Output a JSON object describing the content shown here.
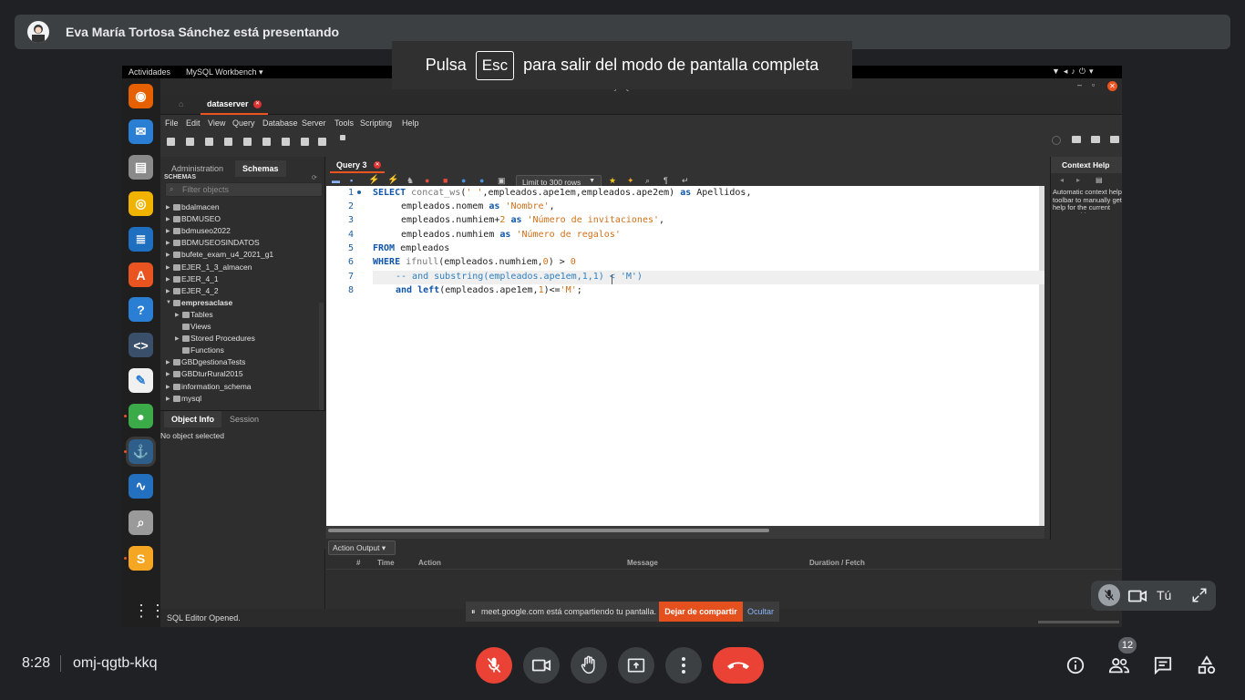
{
  "presenter": {
    "name": "Eva María Tortosa Sánchez está presentando"
  },
  "fullscreen_hint": {
    "prefix": "Pulsa",
    "key": "Esc",
    "suffix": "para salir del modo de pantalla completa"
  },
  "ubuntu": {
    "activities": "Actividades",
    "app_menu": "MySQL Workbench ▾"
  },
  "dock": [
    {
      "name": "firefox-icon",
      "color": "#e66000",
      "glyph": "◉"
    },
    {
      "name": "thunderbird-icon",
      "color": "#2a7fd4",
      "glyph": "✉"
    },
    {
      "name": "files-icon",
      "color": "#8a8a8a",
      "glyph": "▤"
    },
    {
      "name": "rhythmbox-icon",
      "color": "#f0b400",
      "glyph": "◎"
    },
    {
      "name": "writer-icon",
      "color": "#1e6fc0",
      "glyph": "≣"
    },
    {
      "name": "software-icon",
      "color": "#e95420",
      "glyph": "A"
    },
    {
      "name": "help-icon",
      "color": "#2a7fd4",
      "glyph": "?"
    },
    {
      "name": "code-editor-icon",
      "color": "#3a4f6a",
      "glyph": "<>"
    },
    {
      "name": "text-editor-icon",
      "color": "#f0f0f0",
      "glyph": "✎"
    },
    {
      "name": "chrome-icon",
      "color": "#3bab4a",
      "glyph": "●"
    },
    {
      "name": "mysql-workbench-icon",
      "color": "#2e5e8a",
      "glyph": "⚓"
    },
    {
      "name": "system-monitor-icon",
      "color": "#2470c0",
      "glyph": "∿"
    },
    {
      "name": "magnifier-icon",
      "color": "#9a9a9a",
      "glyph": "⌕"
    },
    {
      "name": "sublime-icon",
      "color": "#f5a623",
      "glyph": "S"
    }
  ],
  "workbench": {
    "window_title": "MySQL Workbench",
    "connection_tab": "dataserver",
    "menu": [
      "File",
      "Edit",
      "View",
      "Query",
      "Database",
      "Server",
      "Tools",
      "Scripting",
      "Help"
    ],
    "nav_tabs": [
      "Administration",
      "Schemas"
    ],
    "schemas_header": "SCHEMAS",
    "filter_placeholder": "Filter objects",
    "schemas": [
      {
        "label": "bdalmacen",
        "bold": false,
        "indent": 0
      },
      {
        "label": "BDMUSEO",
        "bold": false,
        "indent": 0
      },
      {
        "label": "bdmuseo2022",
        "bold": false,
        "indent": 0
      },
      {
        "label": "BDMUSEOSINDATOS",
        "bold": false,
        "indent": 0
      },
      {
        "label": "bufete_exam_u4_2021_g1",
        "bold": false,
        "indent": 0
      },
      {
        "label": "EJER_1_3_almacen",
        "bold": false,
        "indent": 0
      },
      {
        "label": "EJER_4_1",
        "bold": false,
        "indent": 0
      },
      {
        "label": "EJER_4_2",
        "bold": false,
        "indent": 0
      },
      {
        "label": "empresaclase",
        "bold": true,
        "indent": 0
      },
      {
        "label": "Tables",
        "bold": false,
        "indent": 1
      },
      {
        "label": "Views",
        "bold": false,
        "indent": 1
      },
      {
        "label": "Stored Procedures",
        "bold": false,
        "indent": 1
      },
      {
        "label": "Functions",
        "bold": false,
        "indent": 1
      },
      {
        "label": "GBDgestionaTests",
        "bold": false,
        "indent": 0
      },
      {
        "label": "GBDturRural2015",
        "bold": false,
        "indent": 0
      },
      {
        "label": "information_schema",
        "bold": false,
        "indent": 0
      },
      {
        "label": "mysql",
        "bold": false,
        "indent": 0
      }
    ],
    "info_tabs": [
      "Object Info",
      "Session"
    ],
    "no_object": "No object selected",
    "query_tab": "Query 3",
    "limit_select": "Limit to 300 rows",
    "line_numbers": [
      "1",
      "2",
      "3",
      "4",
      "5",
      "6",
      "7",
      "8"
    ],
    "code": {
      "l1_kw": "SELECT",
      "l1_fn": "concat_ws",
      "l1_a": "(",
      "l1_str": "' '",
      "l1_b": ",empleados.ape1em,empleados.ape2em)",
      "l1_as": "as",
      "l1_c": "Apellidos,",
      "l2_a": "empleados.nomem",
      "l2_as": "as",
      "l2_str": "'Nombre'",
      "l2_c": ",",
      "l3_a": "empleados.numhiem+",
      "l3_num": "2",
      "l3_as": "as",
      "l3_str": "'Número de invitaciones'",
      "l3_c": ",",
      "l4_a": "empleados.numhiem",
      "l4_as": "as",
      "l4_str": "'Número de regalos'",
      "l5_kw": "FROM",
      "l5_a": "empleados",
      "l6_kw": "WHERE",
      "l6_fn": "ifnull",
      "l6_a": "(empleados.numhiem,",
      "l6_n0": "0",
      "l6_b": ") > ",
      "l6_n1": "0",
      "l7_cm": "-- and substring(empleados.ape1em,1,1) < 'M')",
      "l8_kw": "and",
      "l8_fn": "left",
      "l8_a": "(empleados.ape1em,",
      "l8_n": "1",
      "l8_b": ")<=",
      "l8_str": "'M'",
      "l8_c": ";"
    },
    "action_output": "Action Output ▾",
    "output_cols": [
      "#",
      "Time",
      "Action",
      "Message",
      "Duration / Fetch"
    ],
    "context_help_title": "Context Help",
    "context_help_text": "Automatic context help toolbar to manually get help for the current caret position or to",
    "status": "SQL Editor Opened."
  },
  "share_notice": {
    "text": "meet.google.com está compartiendo tu pantalla.",
    "stop": "Dejar de compartir",
    "hide": "Ocultar"
  },
  "self_view": {
    "label": "Tú"
  },
  "meet": {
    "time": "8:28",
    "code": "omj-qgtb-kkq",
    "participants": "12"
  },
  "colors": {
    "end_call": "#ea4335",
    "mic_off": "#ea4335",
    "stop_share": "#e4501e",
    "badge": "#5f6368"
  }
}
